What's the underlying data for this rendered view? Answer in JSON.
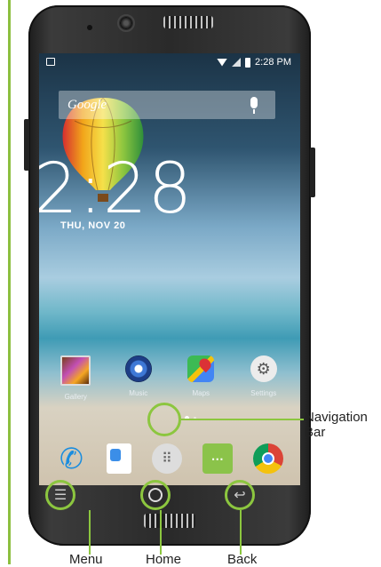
{
  "status_bar": {
    "time": "2:28 PM"
  },
  "search_bar": {
    "logo_text": "Google"
  },
  "lock_widget": {
    "clock": "2:28",
    "date": "THU, NOV 20"
  },
  "home_apps": [
    {
      "label": "Gallery",
      "icon": "gallery-icon"
    },
    {
      "label": "Music",
      "icon": "music-icon"
    },
    {
      "label": "Maps",
      "icon": "maps-icon"
    },
    {
      "label": "Settings",
      "icon": "settings-icon"
    }
  ],
  "dock_apps": [
    {
      "icon": "phone-icon"
    },
    {
      "icon": "contacts-icon"
    },
    {
      "icon": "app-launcher-icon"
    },
    {
      "icon": "messaging-icon"
    },
    {
      "icon": "chrome-icon"
    }
  ],
  "annotations": {
    "navigation_bar": "Navigation Bar",
    "menu": "Menu",
    "home": "Home",
    "back": "Back"
  },
  "colors": {
    "callout_green": "#8cc63f",
    "phone_body": "#2a2a2a"
  }
}
